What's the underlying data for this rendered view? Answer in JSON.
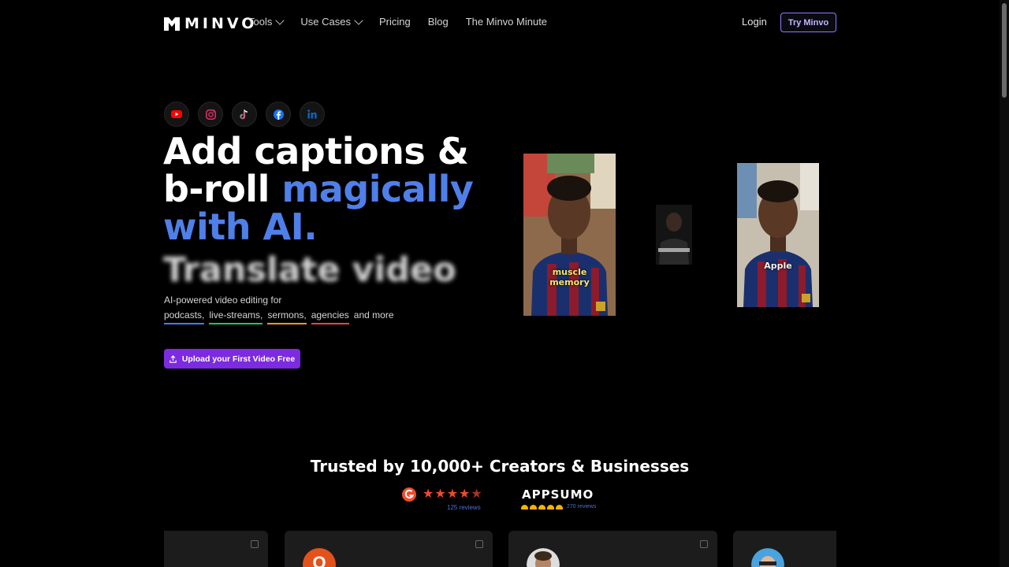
{
  "brand": {
    "name": "MINVO"
  },
  "nav": {
    "tools": "Tools",
    "use_cases": "Use Cases",
    "pricing": "Pricing",
    "blog": "Blog",
    "minute": "The Minvo Minute",
    "login": "Login",
    "try": "Try Minvo"
  },
  "socials": [
    "youtube-icon",
    "instagram-icon",
    "tiktok-icon",
    "facebook-icon",
    "linkedin-icon"
  ],
  "hero": {
    "line1": "Add captions &",
    "line2_white": "b-roll ",
    "line2_blue": "magically",
    "line3": "with AI.",
    "rotating": "Translate video",
    "sub": "AI-powered video editing for",
    "tags": [
      "podcasts,",
      "live-streams,",
      "sermons,",
      "agencies"
    ],
    "and_more": "and more",
    "cta": "Upload your First Video Free"
  },
  "videos": {
    "caption1_line1": "muscle",
    "caption1_line2": "memory",
    "caption3": "Apple"
  },
  "trusted": {
    "title": "Trusted by 10,000+ Creators & Businesses",
    "g2_reviews": "125 reviews",
    "g2_rating": 4.5,
    "appsumo": "APPSUMO",
    "appsumo_reviews": "270 reviews"
  },
  "reviews": {
    "card2_initial": "O"
  },
  "colors": {
    "accent_purple": "#7c2be0",
    "headline_blue": "#4f7fe8",
    "g2_red": "#ef4b2b"
  }
}
